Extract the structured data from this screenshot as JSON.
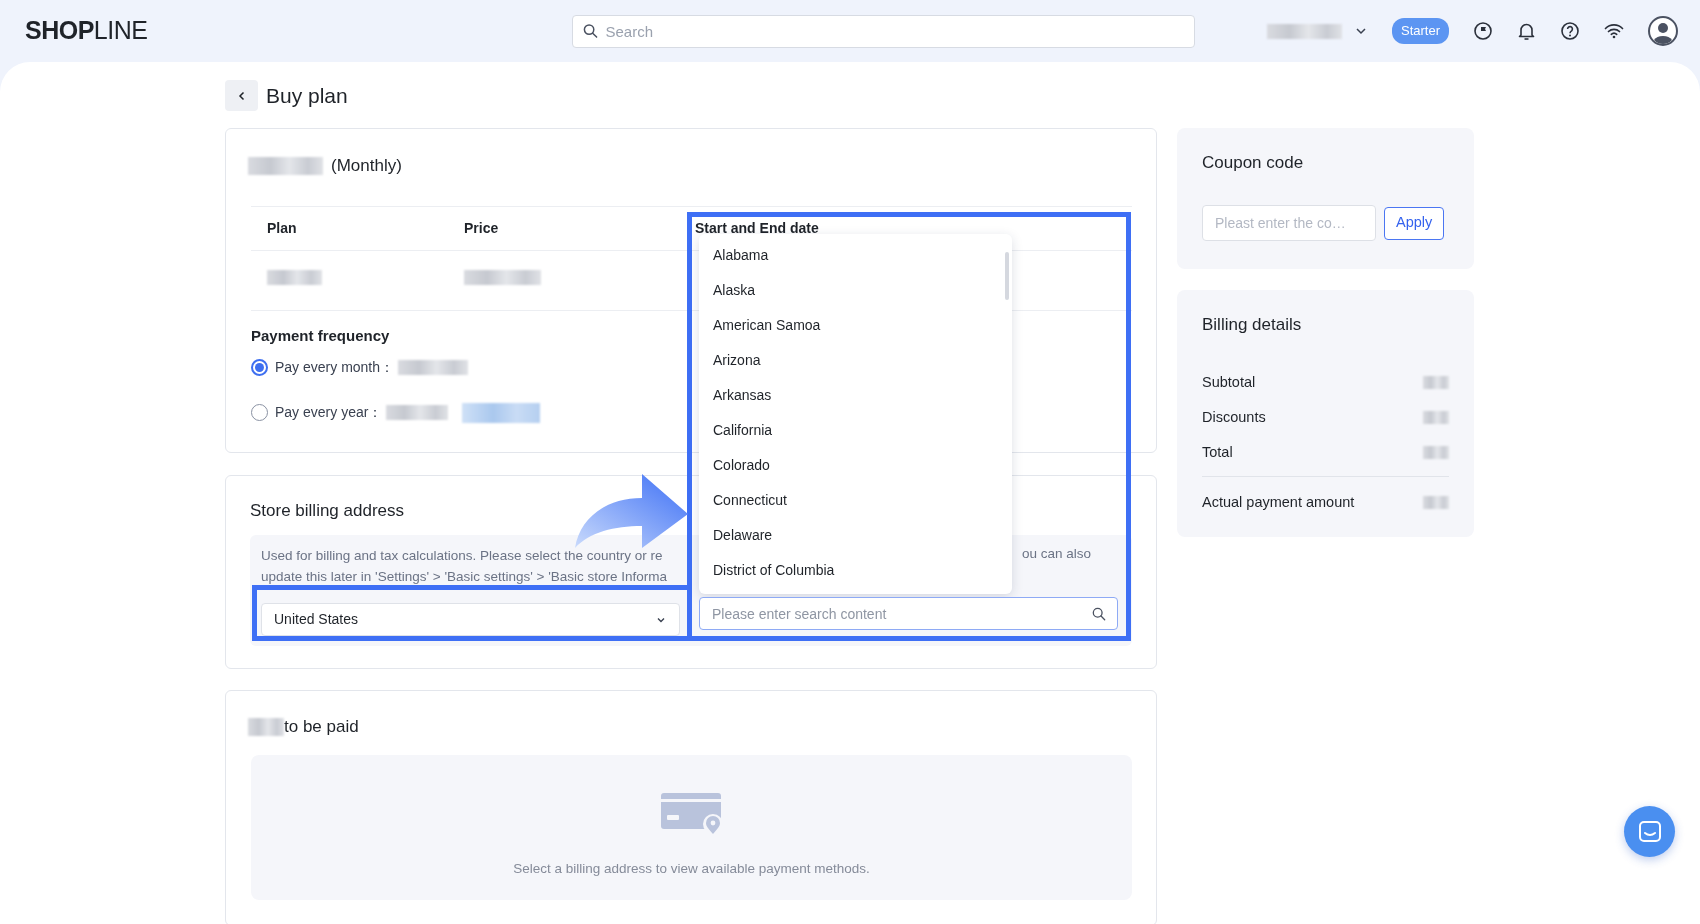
{
  "header": {
    "logo": "**SHOP**LINE",
    "search": {
      "placeholder": "Search"
    },
    "plan_badge": "Starter"
  },
  "page_title": "Buy plan",
  "plan_card": {
    "title_suffix": "(Monthly)",
    "table": {
      "columns": [
        "Plan",
        "Price",
        "Start and End date"
      ]
    },
    "payment_frequency": {
      "title": "Payment frequency",
      "options": [
        {
          "label": "Pay every month：",
          "selected": true
        },
        {
          "label": "Pay every year：",
          "selected": false
        }
      ]
    }
  },
  "billing_address": {
    "title": "Store billing address",
    "note": [
      "Used for billing and tax calculations. Please select the country or re",
      "update this later in 'Settings' > 'Basic settings' > 'Basic store Informa",
      "ou can also"
    ],
    "country": {
      "value": "United States"
    },
    "region_dropdown": {
      "items": [
        "Alabama",
        "Alaska",
        "American Samoa",
        "Arizona",
        "Arkansas",
        "California",
        "Colorado",
        "Connecticut",
        "Delaware",
        "District of Columbia"
      ],
      "search": {
        "placeholder": "Please enter search content"
      }
    }
  },
  "payment_card": {
    "title_suffix": "to be paid",
    "empty_message": "Select a billing address to view available payment methods."
  },
  "coupon": {
    "title": "Coupon code",
    "placeholder": "Pleast enter the co…",
    "button": "Apply"
  },
  "billing_details": {
    "title": "Billing details",
    "rows": [
      {
        "label": "Subtotal"
      },
      {
        "label": "Discounts"
      },
      {
        "label": "Total"
      }
    ],
    "total": {
      "label": "Actual payment amount"
    }
  }
}
